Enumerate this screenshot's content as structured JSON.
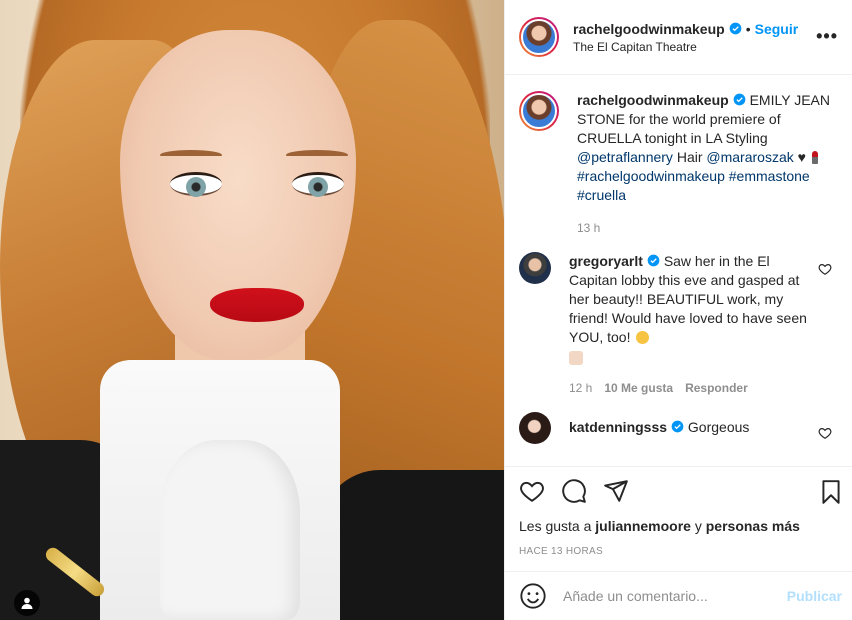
{
  "photo": {
    "alt_icon": "person-tag-icon"
  },
  "header": {
    "username": "rachelgoodwinmakeup",
    "separator": "•",
    "follow_label": "Seguir",
    "location": "The El Capitan Theatre",
    "more_icon": "more-horizontal-icon",
    "more_label": "•••"
  },
  "caption": {
    "username": "rachelgoodwinmakeup",
    "text_part1": "EMILY JEAN STONE for the world premiere of CRUELLA tonight in LA Styling",
    "mention1": "@petraflannery",
    "text_part2": "Hair",
    "mention2": "@mararoszak",
    "heart": "♥",
    "hashtag1": "#rachelgoodwinmakeup",
    "hashtag2": "#emmastone",
    "hashtag3": "#cruella",
    "time": "13 h"
  },
  "comments": [
    {
      "username": "gregoryarlt",
      "text": "Saw her in the El Capitan lobby this eve and gasped at her beauty!! BEAUTIFUL work, my friend! Would have loved to have seen YOU, too!",
      "time": "12 h",
      "likes": "10 Me gusta",
      "reply": "Responder"
    },
    {
      "username": "katdenningsss",
      "text": "Gorgeous"
    }
  ],
  "actions": {
    "likes_prefix": "Les gusta a",
    "likes_user": "juliannemoore",
    "likes_and": "y",
    "likes_others": "personas más",
    "timestamp": "HACE 13 HORAS"
  },
  "add_comment": {
    "placeholder": "Añade un comentario...",
    "post_label": "Publicar"
  },
  "colors": {
    "accent": "#0095f6",
    "link": "#00376b",
    "muted": "#8e8e8e",
    "post_disabled": "#b2dffc"
  }
}
